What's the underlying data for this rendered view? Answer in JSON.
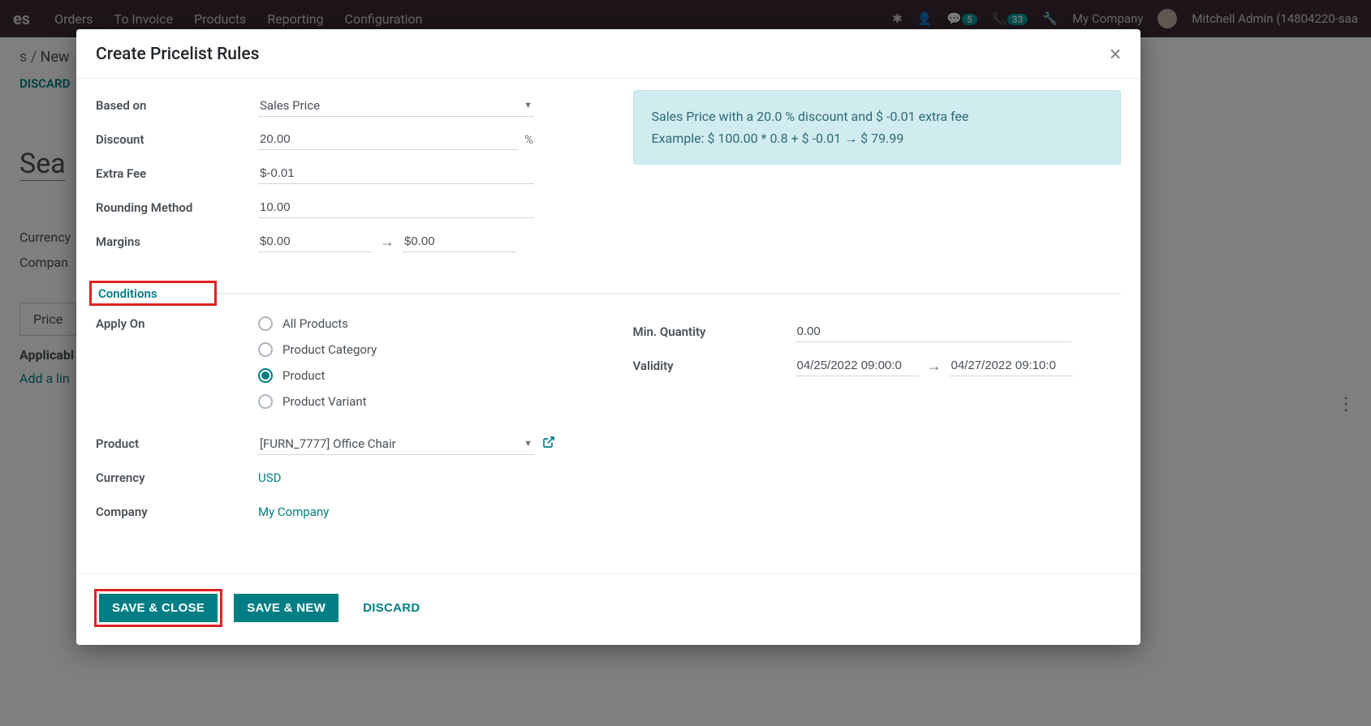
{
  "topbar": {
    "brand": "es",
    "nav": [
      "Orders",
      "To Invoice",
      "Products",
      "Reporting",
      "Configuration"
    ],
    "badge_msg": "5",
    "badge_call": "33",
    "company": "My Company",
    "user": "Mitchell Admin (14804220-saa"
  },
  "background": {
    "breadcrumb_prefix": "s /",
    "breadcrumb_new": "New",
    "discard": "DISCARD",
    "title_fragment": "Sea",
    "currency_label": "Currency",
    "company_label": "Compan",
    "tab_label": "Price",
    "applicable_label": "Applicabl",
    "add_line": "Add a lin"
  },
  "modal": {
    "title": "Create Pricelist Rules",
    "close": "×",
    "fields": {
      "based_on_label": "Based on",
      "based_on_value": "Sales Price",
      "discount_label": "Discount",
      "discount_value": "20.00",
      "discount_suffix": "%",
      "extra_fee_label": "Extra Fee",
      "extra_fee_value": "$-0.01",
      "rounding_label": "Rounding Method",
      "rounding_value": "10.00",
      "margins_label": "Margins",
      "margins_min": "$0.00",
      "margins_max": "$0.00"
    },
    "info": {
      "line1": "Sales Price with a 20.0 % discount and $ -0.01 extra fee",
      "line2": "Example: $ 100.00 * 0.8 + $ -0.01 → $ 79.99"
    },
    "section_conditions": "Conditions",
    "apply_on": {
      "label": "Apply On",
      "options": {
        "all": "All Products",
        "category": "Product Category",
        "product": "Product",
        "variant": "Product Variant"
      },
      "selected": "product"
    },
    "min_qty_label": "Min. Quantity",
    "min_qty_value": "0.00",
    "validity_label": "Validity",
    "validity_from": "04/25/2022 09:00:0",
    "validity_to": "04/27/2022 09:10:0",
    "product_label": "Product",
    "product_value": "[FURN_7777] Office Chair",
    "currency_label": "Currency",
    "currency_value": "USD",
    "company_label": "Company",
    "company_value": "My Company",
    "footer": {
      "save_close": "Save & Close",
      "save_new": "Save & New",
      "discard": "Discard"
    }
  }
}
